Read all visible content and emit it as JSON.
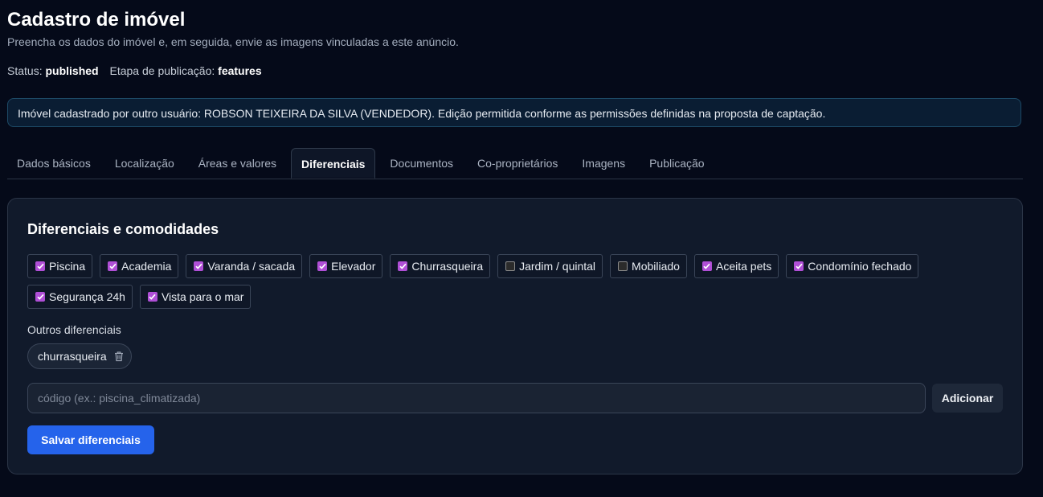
{
  "header": {
    "title": "Cadastro de imóvel",
    "subtitle": "Preencha os dados do imóvel e, em seguida, envie as imagens vinculadas a este anúncio.",
    "status_label": "Status:",
    "status_value": "published",
    "stage_label": "Etapa de publicação:",
    "stage_value": "features"
  },
  "notice": {
    "text": "Imóvel cadastrado por outro usuário: ROBSON TEIXEIRA DA SILVA (VENDEDOR). Edição permitida conforme as permissões definidas na proposta de captação."
  },
  "tabs": [
    {
      "label": "Dados básicos",
      "active": false
    },
    {
      "label": "Localização",
      "active": false
    },
    {
      "label": "Áreas e valores",
      "active": false
    },
    {
      "label": "Diferenciais",
      "active": true
    },
    {
      "label": "Documentos",
      "active": false
    },
    {
      "label": "Co-proprietários",
      "active": false
    },
    {
      "label": "Imagens",
      "active": false
    },
    {
      "label": "Publicação",
      "active": false
    }
  ],
  "features_card": {
    "title": "Diferenciais e comodidades",
    "options": [
      {
        "label": "Piscina",
        "checked": true
      },
      {
        "label": "Academia",
        "checked": true
      },
      {
        "label": "Varanda / sacada",
        "checked": true
      },
      {
        "label": "Elevador",
        "checked": true
      },
      {
        "label": "Churrasqueira",
        "checked": true
      },
      {
        "label": "Jardim / quintal",
        "checked": false
      },
      {
        "label": "Mobiliado",
        "checked": false
      },
      {
        "label": "Aceita pets",
        "checked": true
      },
      {
        "label": "Condomínio fechado",
        "checked": true
      },
      {
        "label": "Segurança 24h",
        "checked": true
      },
      {
        "label": "Vista para o mar",
        "checked": true
      }
    ],
    "others_label": "Outros diferenciais",
    "custom_tags": [
      "churrasqueira"
    ],
    "code_input": {
      "value": "",
      "placeholder": "código (ex.: piscina_climatizada)"
    },
    "add_label": "Adicionar",
    "save_label": "Salvar diferenciais"
  },
  "colors": {
    "background": "#050a19",
    "card": "#111a2b",
    "checkbox_checked": "#b04fd6",
    "primary_button": "#2563eb",
    "notice_border": "#1d4a66"
  },
  "icons": {
    "checkbox_checked": "check-icon",
    "tag_remove": "trash-icon"
  }
}
